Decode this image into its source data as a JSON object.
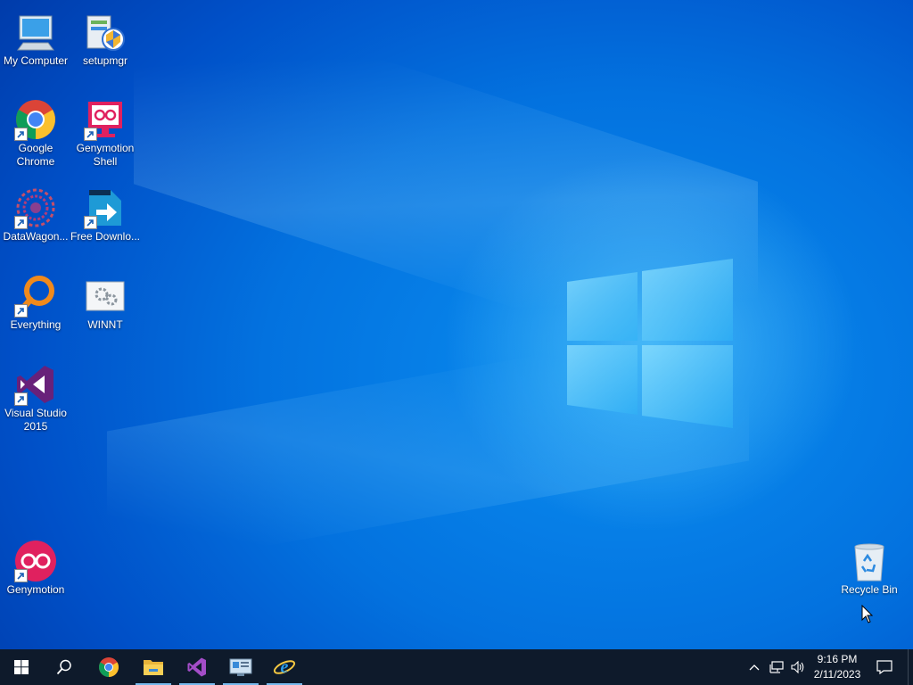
{
  "desktop": {
    "icons": [
      {
        "label": "My Computer"
      },
      {
        "label": "setupmgr"
      },
      {
        "label": "Google Chrome"
      },
      {
        "label": "Genymotion Shell"
      },
      {
        "label": "DataWagon..."
      },
      {
        "label": "Free Downlo..."
      },
      {
        "label": "Everything"
      },
      {
        "label": "WINNT"
      },
      {
        "label": "Visual Studio 2015"
      },
      {
        "label": "Genymotion"
      },
      {
        "label": "Recycle Bin"
      }
    ]
  },
  "taskbar": {
    "pinned": [
      "windows-start-icon",
      "search-icon",
      "chrome-icon",
      "file-explorer-icon",
      "visual-studio-icon",
      "control-panel-icon",
      "internet-explorer-icon"
    ],
    "clock": {
      "time": "9:16 PM",
      "date": "2/11/2023"
    }
  },
  "colors": {
    "taskbar": "#0e1a2b",
    "desktop": "#0372df"
  }
}
